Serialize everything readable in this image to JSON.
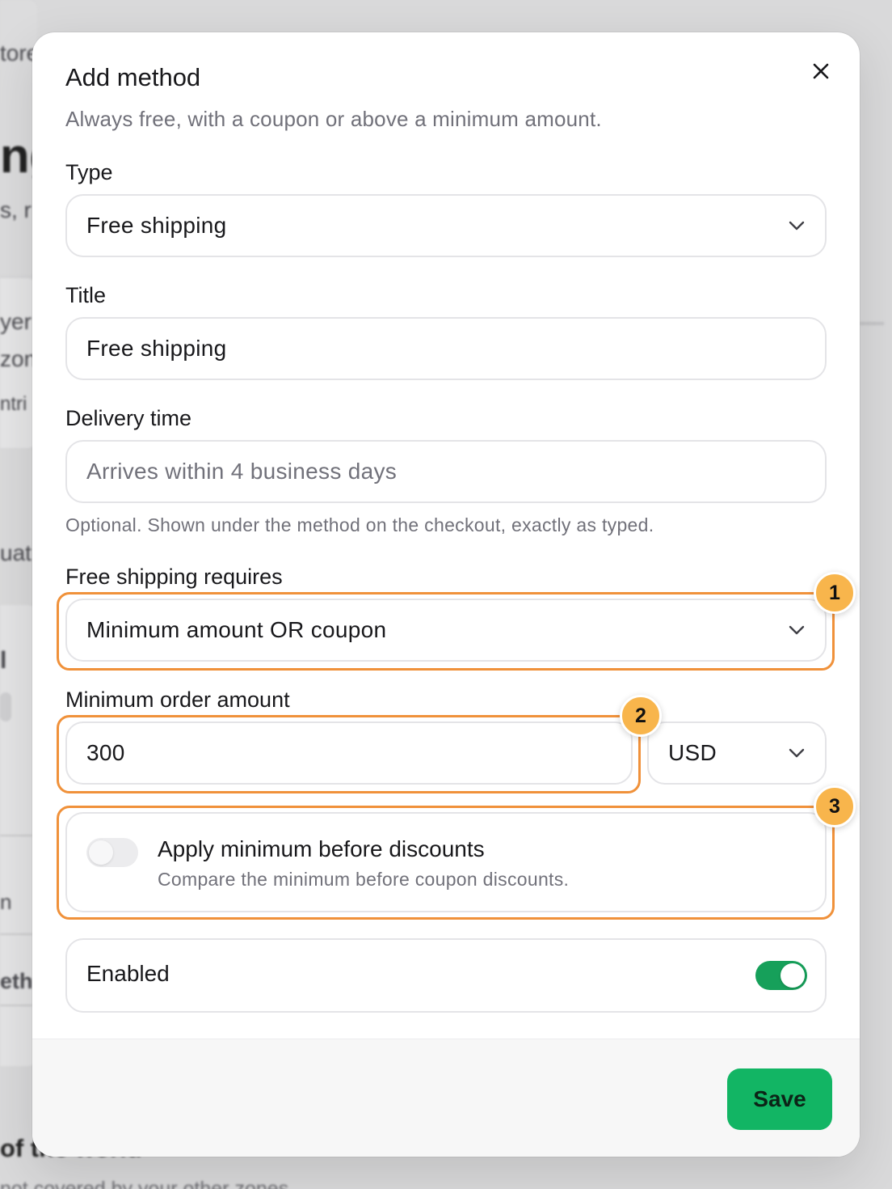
{
  "background": {
    "fragments": [
      "tore",
      "ng",
      "s, r",
      "yer",
      "zon",
      "ntri",
      "uat",
      "l",
      "n",
      "eth",
      "of the world",
      "not covered by your other zones"
    ]
  },
  "modal": {
    "title": "Add method",
    "subtitle": "Always free, with a coupon or above a minimum amount.",
    "close_icon": "close-icon",
    "type": {
      "label": "Type",
      "value": "Free shipping"
    },
    "title_field": {
      "label": "Title",
      "value": "Free shipping"
    },
    "delivery_time": {
      "label": "Delivery time",
      "placeholder": "Arrives within 4 business days",
      "hint": "Optional. Shown under the method on the checkout, exactly as typed."
    },
    "requires": {
      "label": "Free shipping requires",
      "value": "Minimum amount OR coupon"
    },
    "minimum": {
      "label": "Minimum order amount",
      "value": "300",
      "currency": "USD"
    },
    "apply_before_discounts": {
      "title": "Apply minimum before discounts",
      "description": "Compare the minimum before coupon discounts.",
      "on": false
    },
    "enabled": {
      "label": "Enabled",
      "on": true
    },
    "save_label": "Save"
  },
  "annotations": [
    "1",
    "2",
    "3"
  ],
  "colors": {
    "accent_green": "#12b564",
    "toggle_green": "#16a05a",
    "highlight_orange": "#f0913a",
    "badge_fill": "#f8b54c"
  }
}
